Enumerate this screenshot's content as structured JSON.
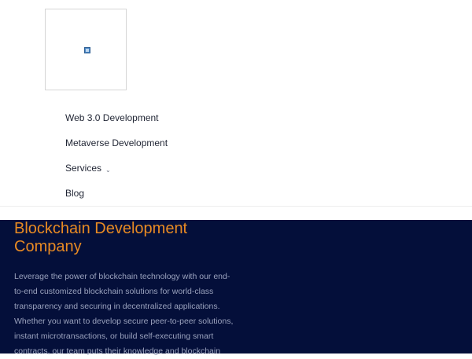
{
  "nav": {
    "items": [
      {
        "label": "Web 3.0 Development"
      },
      {
        "label": "Metaverse Development"
      },
      {
        "label": "Services",
        "dropdown_icon": "chevron-down-icon"
      },
      {
        "label": "Blog"
      }
    ]
  },
  "hero": {
    "title": "Blockchain Development Company",
    "description": "Leverage the power of blockchain technology with our end-to-end customized blockchain solutions for world-class transparency and securing in decentralized applications. Whether you want to develop secure peer-to-peer solutions, instant microtransactions, or build self-executing smart contracts, our team puts their knowledge and blockchain"
  },
  "colors": {
    "hero_background": "#040f3a",
    "hero_title": "#e88a23",
    "hero_text": "#9aa2bd",
    "nav_text": "#1f2433"
  }
}
